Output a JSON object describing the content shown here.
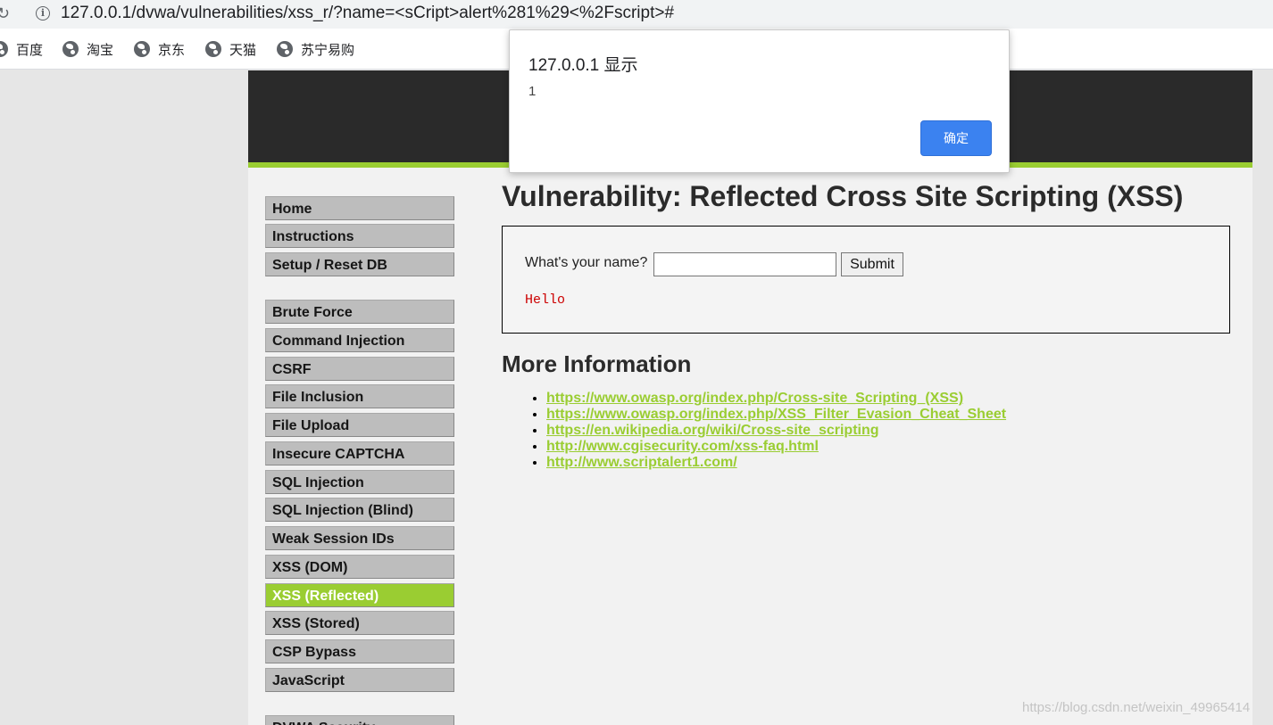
{
  "browser": {
    "url": "127.0.0.1/dvwa/vulnerabilities/xss_r/?name=<sCript>alert%281%29<%2Fscript>#",
    "bookmarks": [
      "百度",
      "淘宝",
      "京东",
      "天猫",
      "苏宁易购"
    ]
  },
  "dialog": {
    "title": "127.0.0.1 显示",
    "message": "1",
    "ok_label": "确定"
  },
  "sidebar": {
    "items": [
      {
        "label": "Home"
      },
      {
        "label": "Instructions"
      },
      {
        "label": "Setup / Reset DB"
      },
      {
        "label": "Brute Force"
      },
      {
        "label": "Command Injection"
      },
      {
        "label": "CSRF"
      },
      {
        "label": "File Inclusion"
      },
      {
        "label": "File Upload"
      },
      {
        "label": "Insecure CAPTCHA"
      },
      {
        "label": "SQL Injection"
      },
      {
        "label": "SQL Injection (Blind)"
      },
      {
        "label": "Weak Session IDs"
      },
      {
        "label": "XSS (DOM)"
      },
      {
        "label": "XSS (Reflected)"
      },
      {
        "label": "XSS (Stored)"
      },
      {
        "label": "CSP Bypass"
      },
      {
        "label": "JavaScript"
      },
      {
        "label": "DVWA Security"
      }
    ]
  },
  "main": {
    "title": "Vulnerability: Reflected Cross Site Scripting (XSS)",
    "form": {
      "question": "What's your name?",
      "input_value": "",
      "submit_label": "Submit",
      "output": "Hello"
    },
    "more_info_title": "More Information",
    "links": [
      "https://www.owasp.org/index.php/Cross-site_Scripting_(XSS)",
      "https://www.owasp.org/index.php/XSS_Filter_Evasion_Cheat_Sheet",
      "https://en.wikipedia.org/wiki/Cross-site_scripting",
      "http://www.cgisecurity.com/xss-faq.html",
      "http://www.scriptalert1.com/"
    ]
  },
  "watermark": "https://blog.csdn.net/weixin_49965414",
  "colors": {
    "accent_green": "#9acd32",
    "header_dark": "#2a2a2a",
    "dialog_button": "#3b82f0"
  }
}
